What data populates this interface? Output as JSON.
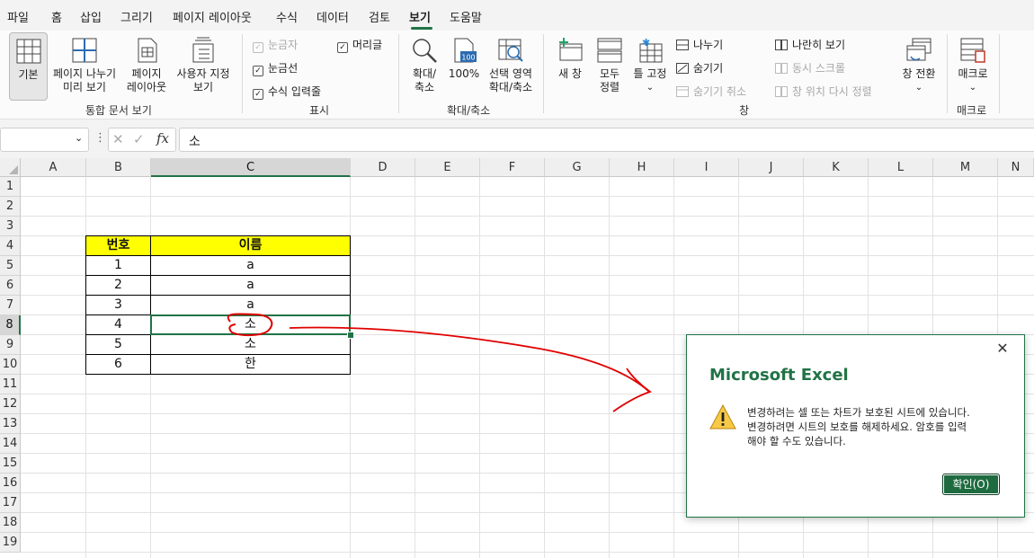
{
  "menu": {
    "tabs": [
      "파일",
      "홈",
      "삽입",
      "그리기",
      "페이지 레이아웃",
      "수식",
      "데이터",
      "검토",
      "보기",
      "도움말"
    ],
    "active_tab": "보기"
  },
  "ribbon": {
    "workbook_views": {
      "normal": "기본",
      "page_break_line1": "페이지 나누기",
      "page_break_line2": "미리 보기",
      "page_layout_line1": "페이지",
      "page_layout_line2": "레이아웃",
      "custom_line1": "사용자 지정",
      "custom_line2": "보기",
      "label": "통합 문서 보기"
    },
    "show": {
      "ruler": "눈금자",
      "gridlines": "눈금선",
      "formula_bar": "수식 입력줄",
      "headings": "머리글",
      "label": "표시"
    },
    "zoom": {
      "zoom_line1": "확대/",
      "zoom_line2": "축소",
      "hundred": "100%",
      "hundred_icon_text": "100",
      "selection_line1": "선택 영역",
      "selection_line2": "확대/축소",
      "label": "확대/축소"
    },
    "window": {
      "new_window": "새 창",
      "arrange_line1": "모두",
      "arrange_line2": "정렬",
      "freeze": "틀 고정",
      "split": "나누기",
      "hide": "숨기기",
      "unhide": "숨기기 취소",
      "side_by_side": "나란히 보기",
      "sync_scroll": "동시 스크롤",
      "reset_position": "창 위치 다시 정렬",
      "switch": "창 전환",
      "label": "창"
    },
    "macros": {
      "macros": "매크로",
      "label": "매크로"
    }
  },
  "formula_bar": {
    "name_box": "",
    "fx": "fx",
    "content": "소"
  },
  "sheet": {
    "columns": [
      "A",
      "B",
      "C",
      "D",
      "E",
      "F",
      "G",
      "H",
      "I",
      "J",
      "K",
      "L",
      "M",
      "N"
    ],
    "rows": [
      "1",
      "2",
      "3",
      "4",
      "5",
      "6",
      "7",
      "8",
      "9",
      "10",
      "11",
      "12",
      "13",
      "14",
      "15",
      "16",
      "17",
      "18",
      "19"
    ],
    "selected_column": "C",
    "selected_row": "8",
    "table": {
      "headers": [
        "번호",
        "이름"
      ],
      "rows": [
        [
          "1",
          "a"
        ],
        [
          "2",
          "a"
        ],
        [
          "3",
          "a"
        ],
        [
          "4",
          "소"
        ],
        [
          "5",
          "소"
        ],
        [
          "6",
          "한"
        ]
      ]
    }
  },
  "dialog": {
    "title": "Microsoft Excel",
    "close": "✕",
    "message_line1": "변경하려는 셀 또는 차트가 보호된 시트에 있습니다.",
    "message_line2": "변경하려면 시트의 보호를 해제하세요. 암호를 입력",
    "message_line3": "해야 할 수도 있습니다.",
    "ok": "확인(O)"
  },
  "colors": {
    "accent": "#217346",
    "header_fill": "#ffff00",
    "annotation": "#e00000"
  }
}
